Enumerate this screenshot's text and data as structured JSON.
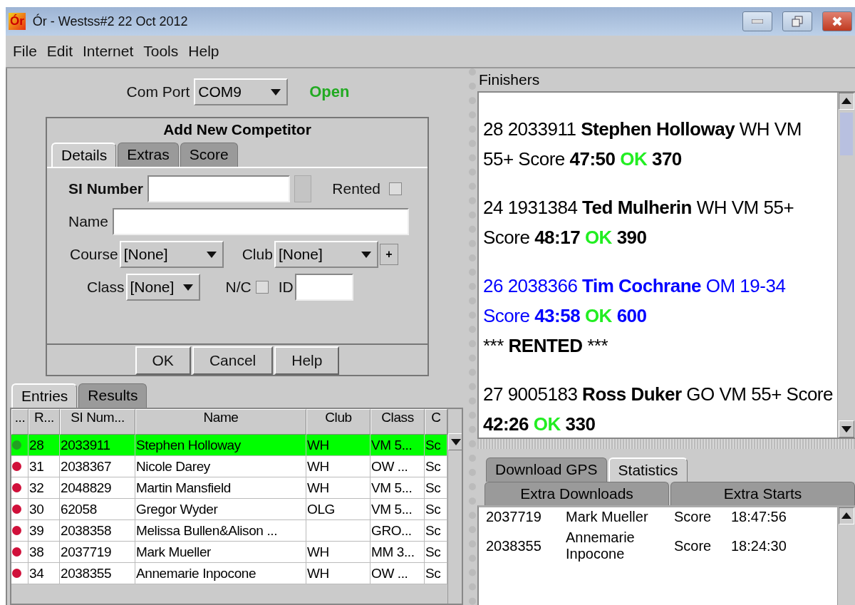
{
  "window": {
    "title": "Ór - Westss#2 22 Oct 2012",
    "logo": "Ór"
  },
  "menu": [
    "File",
    "Edit",
    "Internet",
    "Tools",
    "Help"
  ],
  "com_port": {
    "label": "Com Port",
    "value": "COM9",
    "status": "Open"
  },
  "add_competitor": {
    "title": "Add New Competitor",
    "tabs": [
      {
        "label": "Details",
        "selected": true
      },
      {
        "label": "Extras",
        "selected": false
      },
      {
        "label": "Score",
        "selected": false
      }
    ],
    "si_number_label": "SI Number",
    "rented": {
      "label": "Rented",
      "checked": false
    },
    "name_label": "Name",
    "course": {
      "label": "Course",
      "value": "[None]"
    },
    "club": {
      "label": "Club",
      "value": "[None]",
      "add": "+"
    },
    "class": {
      "label": "Class",
      "value": "[None]"
    },
    "nc": {
      "label": "N/C",
      "checked": false
    },
    "id_label": "ID",
    "buttons": [
      "OK",
      "Cancel",
      "Help"
    ]
  },
  "list_tabs": [
    {
      "label": "Entries",
      "selected": true
    },
    {
      "label": "Results",
      "selected": false
    }
  ],
  "table": {
    "columns": [
      "...",
      "R...",
      "SI Num...",
      "Name",
      "Club",
      "Class",
      "C"
    ],
    "rows": [
      {
        "color": "#22a022",
        "selected": true,
        "cells": [
          "",
          "28",
          "2033911",
          "Stephen Holloway",
          "WH",
          "VM  5...",
          "Sc"
        ]
      },
      {
        "color": "#d0103a",
        "selected": false,
        "cells": [
          "",
          "31",
          "2038367",
          "Nicole Darey",
          "WH",
          "OW   ...",
          "Sc"
        ]
      },
      {
        "color": "#d0103a",
        "selected": false,
        "cells": [
          "",
          "32",
          "2048829",
          "Martin Mansfield",
          "WH",
          "VM  5...",
          "Sc"
        ]
      },
      {
        "color": "#d0103a",
        "selected": false,
        "cells": [
          "",
          "30",
          "62058",
          "Gregor Wyder",
          "OLG",
          "VM  5...",
          "Sc"
        ]
      },
      {
        "color": "#d0103a",
        "selected": false,
        "cells": [
          "",
          "39",
          "2038358",
          "Melissa Bullen&Alison ...",
          "",
          "GRO...",
          "Sc"
        ]
      },
      {
        "color": "#d0103a",
        "selected": false,
        "cells": [
          "",
          "38",
          "2037719",
          "Mark Mueller",
          "WH",
          "MM 3...",
          "Sc"
        ]
      },
      {
        "color": "#d0103a",
        "selected": false,
        "cells": [
          "",
          "34",
          "2038355",
          "Annemarie Inpocone",
          "WH",
          "OW   ...",
          "Sc"
        ]
      }
    ]
  },
  "finishers": {
    "title": "Finishers",
    "items": [
      {
        "color": "#000000",
        "lead": "28 2033911",
        "name": "Stephen Holloway",
        "info": "WH VM 55+ Score",
        "time": "47:50",
        "status": "OK",
        "points": "370"
      },
      {
        "color": "#000000",
        "lead": "24 1931384",
        "name": "Ted Mulherin",
        "info": "WH VM 55+ Score",
        "time": "48:17",
        "status": "OK",
        "points": "390"
      },
      {
        "color": "#0000ff",
        "lead": "26 2038366",
        "name": "Tim Cochrane",
        "info": "OM 19-34 Score",
        "time": "43:58",
        "status": "OK",
        "points": "600",
        "note": {
          "prefix": "***",
          "word": "RENTED",
          "suffix": "***"
        }
      },
      {
        "color": "#000000",
        "lead": "27 9005183",
        "name": "Ross Duker",
        "info": "GO VM 55+ Score",
        "time": "42:26",
        "status": "OK",
        "points": "330"
      }
    ]
  },
  "lower_tabs": [
    [
      {
        "label": "Download GPS",
        "selected": false
      },
      {
        "label": "Statistics",
        "selected": true
      }
    ],
    [
      {
        "label": "Extra Downloads",
        "selected": false
      },
      {
        "label": "Extra Starts",
        "selected": false
      }
    ]
  ],
  "downloads": [
    [
      "2037719",
      "Mark Mueller",
      "Score",
      "18:47:56"
    ],
    [
      "2038355",
      "Annemarie Inpocone",
      "Score",
      "18:24:30"
    ]
  ]
}
